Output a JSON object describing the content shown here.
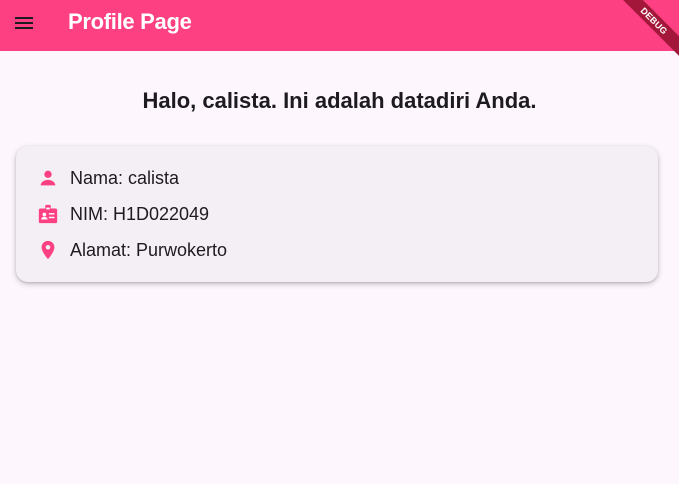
{
  "appbar": {
    "title": "Profile Page",
    "menu_icon": "menu-icon",
    "background": "#fd4081"
  },
  "debug_banner": "DEBUG",
  "greeting": "Halo, calista. Ini adalah datadiri Anda.",
  "profile": {
    "rows": [
      {
        "icon": "person-icon",
        "text": "Nama: calista"
      },
      {
        "icon": "badge-icon",
        "text": "NIM: H1D022049"
      },
      {
        "icon": "location-pin-icon",
        "text": "Alamat: Purwokerto"
      }
    ]
  },
  "colors": {
    "accent": "#fd4081",
    "background": "#fdf7fd",
    "card": "#f4eff4",
    "text": "#1d1b20"
  }
}
